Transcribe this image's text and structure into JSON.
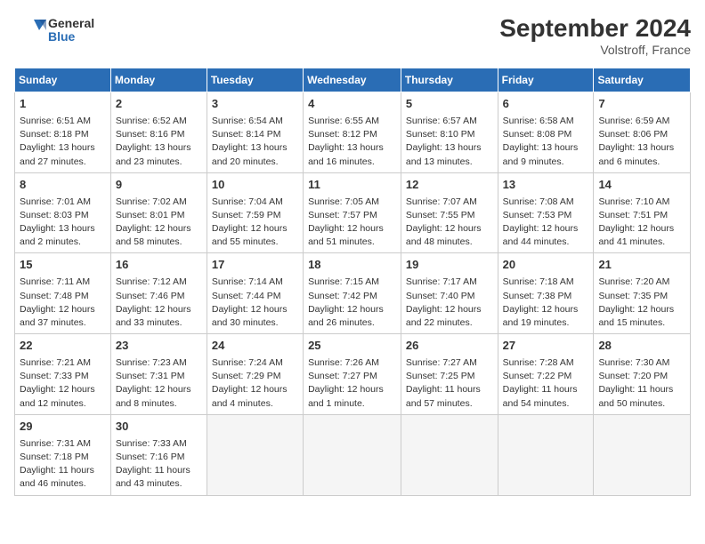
{
  "header": {
    "logo_line1": "General",
    "logo_line2": "Blue",
    "month": "September 2024",
    "location": "Volstroff, France"
  },
  "columns": [
    "Sunday",
    "Monday",
    "Tuesday",
    "Wednesday",
    "Thursday",
    "Friday",
    "Saturday"
  ],
  "weeks": [
    [
      {
        "day": "1",
        "detail": "Sunrise: 6:51 AM\nSunset: 8:18 PM\nDaylight: 13 hours\nand 27 minutes."
      },
      {
        "day": "2",
        "detail": "Sunrise: 6:52 AM\nSunset: 8:16 PM\nDaylight: 13 hours\nand 23 minutes."
      },
      {
        "day": "3",
        "detail": "Sunrise: 6:54 AM\nSunset: 8:14 PM\nDaylight: 13 hours\nand 20 minutes."
      },
      {
        "day": "4",
        "detail": "Sunrise: 6:55 AM\nSunset: 8:12 PM\nDaylight: 13 hours\nand 16 minutes."
      },
      {
        "day": "5",
        "detail": "Sunrise: 6:57 AM\nSunset: 8:10 PM\nDaylight: 13 hours\nand 13 minutes."
      },
      {
        "day": "6",
        "detail": "Sunrise: 6:58 AM\nSunset: 8:08 PM\nDaylight: 13 hours\nand 9 minutes."
      },
      {
        "day": "7",
        "detail": "Sunrise: 6:59 AM\nSunset: 8:06 PM\nDaylight: 13 hours\nand 6 minutes."
      }
    ],
    [
      {
        "day": "8",
        "detail": "Sunrise: 7:01 AM\nSunset: 8:03 PM\nDaylight: 13 hours\nand 2 minutes."
      },
      {
        "day": "9",
        "detail": "Sunrise: 7:02 AM\nSunset: 8:01 PM\nDaylight: 12 hours\nand 58 minutes."
      },
      {
        "day": "10",
        "detail": "Sunrise: 7:04 AM\nSunset: 7:59 PM\nDaylight: 12 hours\nand 55 minutes."
      },
      {
        "day": "11",
        "detail": "Sunrise: 7:05 AM\nSunset: 7:57 PM\nDaylight: 12 hours\nand 51 minutes."
      },
      {
        "day": "12",
        "detail": "Sunrise: 7:07 AM\nSunset: 7:55 PM\nDaylight: 12 hours\nand 48 minutes."
      },
      {
        "day": "13",
        "detail": "Sunrise: 7:08 AM\nSunset: 7:53 PM\nDaylight: 12 hours\nand 44 minutes."
      },
      {
        "day": "14",
        "detail": "Sunrise: 7:10 AM\nSunset: 7:51 PM\nDaylight: 12 hours\nand 41 minutes."
      }
    ],
    [
      {
        "day": "15",
        "detail": "Sunrise: 7:11 AM\nSunset: 7:48 PM\nDaylight: 12 hours\nand 37 minutes."
      },
      {
        "day": "16",
        "detail": "Sunrise: 7:12 AM\nSunset: 7:46 PM\nDaylight: 12 hours\nand 33 minutes."
      },
      {
        "day": "17",
        "detail": "Sunrise: 7:14 AM\nSunset: 7:44 PM\nDaylight: 12 hours\nand 30 minutes."
      },
      {
        "day": "18",
        "detail": "Sunrise: 7:15 AM\nSunset: 7:42 PM\nDaylight: 12 hours\nand 26 minutes."
      },
      {
        "day": "19",
        "detail": "Sunrise: 7:17 AM\nSunset: 7:40 PM\nDaylight: 12 hours\nand 22 minutes."
      },
      {
        "day": "20",
        "detail": "Sunrise: 7:18 AM\nSunset: 7:38 PM\nDaylight: 12 hours\nand 19 minutes."
      },
      {
        "day": "21",
        "detail": "Sunrise: 7:20 AM\nSunset: 7:35 PM\nDaylight: 12 hours\nand 15 minutes."
      }
    ],
    [
      {
        "day": "22",
        "detail": "Sunrise: 7:21 AM\nSunset: 7:33 PM\nDaylight: 12 hours\nand 12 minutes."
      },
      {
        "day": "23",
        "detail": "Sunrise: 7:23 AM\nSunset: 7:31 PM\nDaylight: 12 hours\nand 8 minutes."
      },
      {
        "day": "24",
        "detail": "Sunrise: 7:24 AM\nSunset: 7:29 PM\nDaylight: 12 hours\nand 4 minutes."
      },
      {
        "day": "25",
        "detail": "Sunrise: 7:26 AM\nSunset: 7:27 PM\nDaylight: 12 hours\nand 1 minute."
      },
      {
        "day": "26",
        "detail": "Sunrise: 7:27 AM\nSunset: 7:25 PM\nDaylight: 11 hours\nand 57 minutes."
      },
      {
        "day": "27",
        "detail": "Sunrise: 7:28 AM\nSunset: 7:22 PM\nDaylight: 11 hours\nand 54 minutes."
      },
      {
        "day": "28",
        "detail": "Sunrise: 7:30 AM\nSunset: 7:20 PM\nDaylight: 11 hours\nand 50 minutes."
      }
    ],
    [
      {
        "day": "29",
        "detail": "Sunrise: 7:31 AM\nSunset: 7:18 PM\nDaylight: 11 hours\nand 46 minutes."
      },
      {
        "day": "30",
        "detail": "Sunrise: 7:33 AM\nSunset: 7:16 PM\nDaylight: 11 hours\nand 43 minutes."
      },
      {
        "day": "",
        "detail": ""
      },
      {
        "day": "",
        "detail": ""
      },
      {
        "day": "",
        "detail": ""
      },
      {
        "day": "",
        "detail": ""
      },
      {
        "day": "",
        "detail": ""
      }
    ]
  ]
}
